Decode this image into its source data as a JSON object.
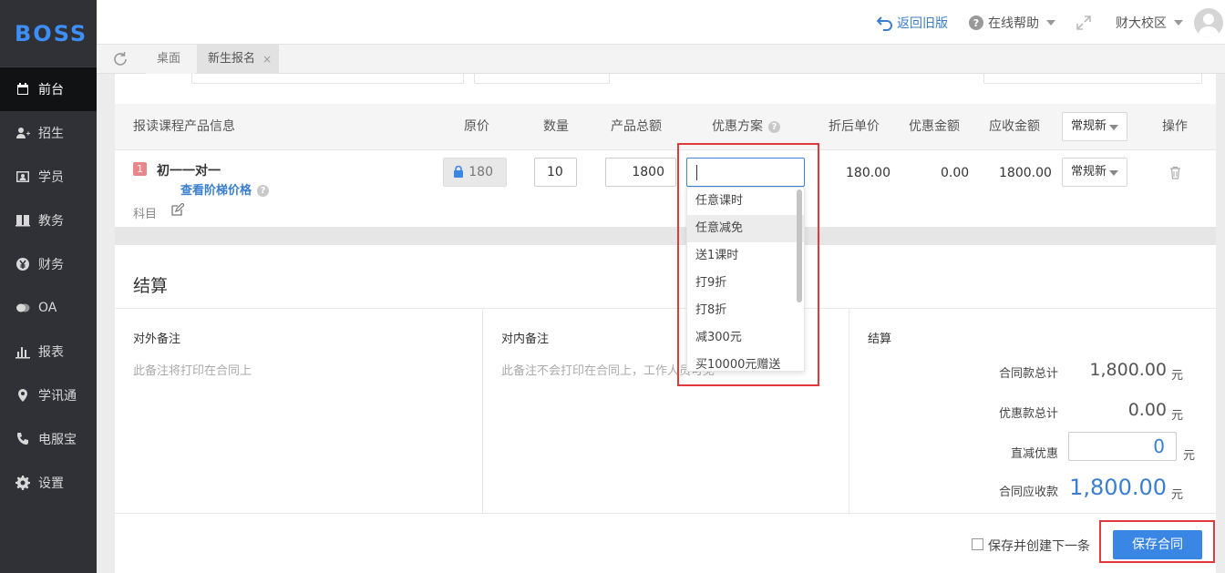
{
  "brand": {
    "logo_text": "BOSS",
    "accent": "#3a86e5",
    "highlight": "#e23a3a"
  },
  "sidebar": {
    "items": [
      {
        "label": "前台",
        "icon": "calendar-icon",
        "active": true
      },
      {
        "label": "招生",
        "icon": "user-add-icon"
      },
      {
        "label": "学员",
        "icon": "id-card-icon"
      },
      {
        "label": "教务",
        "icon": "book-icon"
      },
      {
        "label": "财务",
        "icon": "yen-icon"
      },
      {
        "label": "OA",
        "icon": "chat-icon"
      },
      {
        "label": "报表",
        "icon": "bar-chart-icon"
      },
      {
        "label": "学讯通",
        "icon": "location-icon"
      },
      {
        "label": "电服宝",
        "icon": "phone-icon"
      },
      {
        "label": "设置",
        "icon": "gear-icon"
      }
    ]
  },
  "topbar": {
    "back_label": "返回旧版",
    "help_label": "在线帮助",
    "campus_label": "财大校区"
  },
  "tabs": {
    "items": [
      {
        "label": "桌面"
      },
      {
        "label": "新生报名",
        "close": "×"
      }
    ]
  },
  "table": {
    "headers": {
      "product": "报读课程产品信息",
      "price": "原价",
      "qty": "数量",
      "total": "产品总额",
      "promo": "优惠方案",
      "unit_after": "折后单价",
      "discount_amt": "优惠金额",
      "receivable": "应收金额",
      "type_select": "常规新",
      "ops": "操作"
    },
    "row": {
      "index": "1",
      "course": "初一一对一",
      "ladder_link": "查看阶梯价格",
      "subject_label": "科目",
      "price": "180",
      "qty": "10",
      "total": "1800",
      "promo_value": "",
      "unit_after": "180.00",
      "discount_amt": "0.00",
      "receivable": "1800.00",
      "type_select": "常规新"
    }
  },
  "promo_dropdown": {
    "hovered_index": 1,
    "options": [
      "任意课时",
      "任意减免",
      "送1课时",
      "打9折",
      "打8折",
      "减300元",
      "买10000元赠送"
    ]
  },
  "settlement": {
    "title": "结算",
    "external_note": {
      "title": "对外备注",
      "placeholder": "此备注将打印在合同上"
    },
    "internal_note": {
      "title": "对内备注",
      "placeholder": "此备注不会打印在合同上，工作人员可见"
    },
    "summary": {
      "title": "结算",
      "contract_total_label": "合同款总计",
      "contract_total": "1,800.00",
      "discount_total_label": "优惠款总计",
      "discount_total": "0.00",
      "direct_discount_label": "直减优惠",
      "direct_discount": "0",
      "receivable_label": "合同应收款",
      "receivable": "1,800.00",
      "unit": "元"
    },
    "save_next_label": "保存并创建下一条",
    "save_button": "保存合同"
  }
}
